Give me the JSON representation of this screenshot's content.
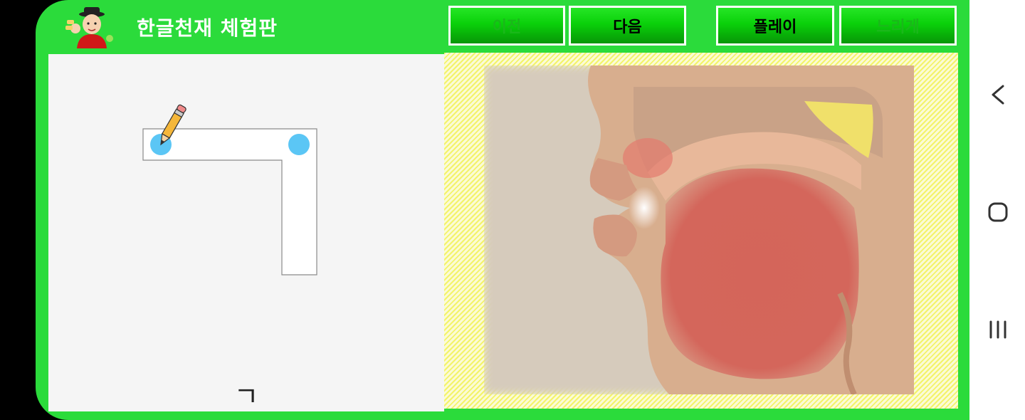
{
  "header": {
    "title": "한글천재 체험판",
    "buttons": {
      "prev": "이전",
      "next": "다음",
      "play": "플레이",
      "slow": "느리게"
    }
  },
  "writing": {
    "letter": "ㄱ"
  },
  "icons": {
    "mascot": "mascot-icon",
    "pencil": "pencil-icon",
    "back": "back-icon",
    "home": "home-icon",
    "recents": "recents-icon"
  },
  "colors": {
    "app_green": "#2bdb3b",
    "button_green": "#0ad00a",
    "dot_blue": "#5bc6f5",
    "panel_bg": "#f5f5f5",
    "hatch_yellow": "#f3f36a"
  }
}
